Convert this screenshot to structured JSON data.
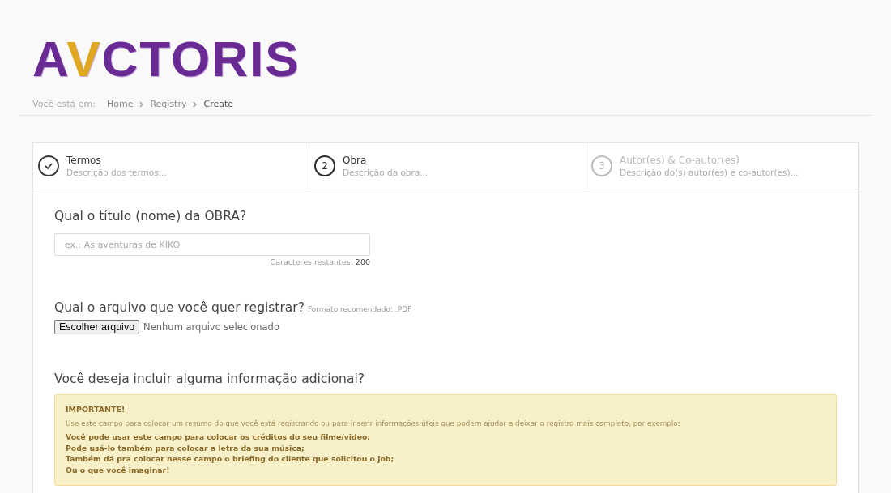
{
  "logo": {
    "text": "AVCTORIS"
  },
  "breadcrumb": {
    "label": "Você está em:",
    "items": [
      {
        "label": "Home",
        "current": false
      },
      {
        "label": "Registry",
        "current": false
      },
      {
        "label": "Create",
        "current": true
      }
    ]
  },
  "steps": [
    {
      "completed": true,
      "selected": false,
      "title": "Termos",
      "description": "Descrição dos termos..."
    },
    {
      "marker": "2",
      "completed": false,
      "selected": true,
      "title": "Obra",
      "description": "Descrição da obra..."
    },
    {
      "marker": "3",
      "completed": false,
      "selected": false,
      "title": "Autor(es) & Co-autor(es)",
      "description": "Descrição do(s) autor(es) e co-autor(es)..."
    }
  ],
  "title_question": {
    "label": "Qual o título (nome) da OBRA?",
    "placeholder": "ex.: As aventuras de KIKO",
    "counter_label": "Caracteres restantes:",
    "counter_value": "200"
  },
  "file_question": {
    "label": "Qual o arquivo que você quer registrar?",
    "hint": "Formato recomendado: .PDF",
    "button": "Escolher arquivo",
    "status": "Nenhum arquivo selecionado"
  },
  "extra_question": {
    "label": "Você deseja incluir alguma informação adicional?"
  },
  "alert": {
    "title": "IMPORTANTE!",
    "intro": "Use este campo para colocar um resumo do que você está registrando ou para inserir informações úteis que podem ajudar a deixar o registro mais completo, por exemplo:",
    "lines": [
      "Você pode usar este campo para colocar os créditos do seu filme/video;",
      "Pode usá-lo também para colocar a letra da sua música;",
      "Também dá pra colocar nesse campo o briefing do cliente que solicitou o job;",
      "Ou o que você imaginar!"
    ]
  }
}
